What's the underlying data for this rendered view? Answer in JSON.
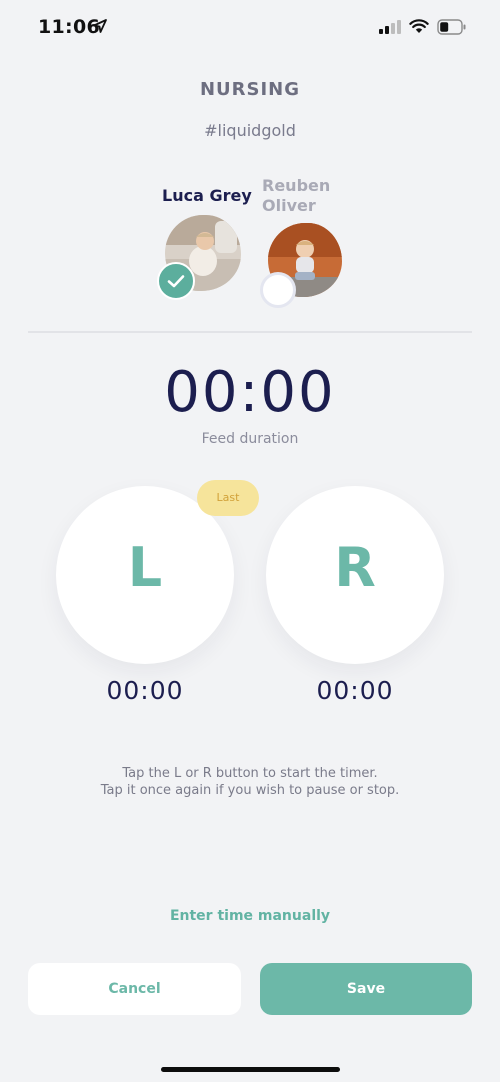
{
  "status_bar": {
    "time": "11:06"
  },
  "header": {
    "title": "NURSING",
    "hashtag": "#liquidgold"
  },
  "babies": [
    {
      "name": "Luca Grey",
      "selected": true
    },
    {
      "name": "Reuben Oliver",
      "selected": false
    }
  ],
  "timer": {
    "total": "00:00",
    "label": "Feed duration"
  },
  "sides": {
    "left": {
      "letter": "L",
      "time": "00:00",
      "badge": "Last"
    },
    "right": {
      "letter": "R",
      "time": "00:00"
    }
  },
  "hint": {
    "line1": "Tap the L or R button to start the timer.",
    "line2": "Tap it once again if you wish to pause or stop."
  },
  "manual_link": "Enter time manually",
  "actions": {
    "cancel": "Cancel",
    "save": "Save"
  },
  "colors": {
    "accent": "#6cb8a8",
    "badge": "#f6e49b",
    "text_dark": "#1c1e4f",
    "background": "#f2f3f5"
  }
}
